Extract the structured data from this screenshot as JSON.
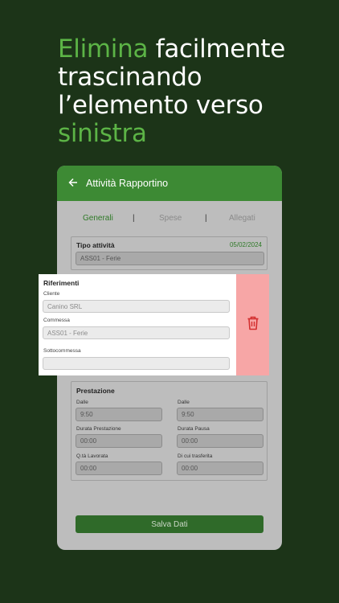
{
  "headline": {
    "part1": "Elimina",
    "part2": " facilmente trascinando l’elemento verso ",
    "part3": "sinistra"
  },
  "appbar": {
    "back_icon": "arrow-left-icon",
    "title": "Attività Rapportino"
  },
  "tabs": [
    {
      "label": "Generali",
      "active": true
    },
    {
      "label": "Spese",
      "active": false
    },
    {
      "label": "Allegati",
      "active": false
    }
  ],
  "tab_separator": "|",
  "tipo_attivita": {
    "label": "Tipo attività",
    "date": "05/02/2024",
    "value": "ASS01 - Ferie"
  },
  "riferimenti": {
    "title": "Riferimenti",
    "cliente_label": "Cliente",
    "cliente_value": "Canino SRL",
    "commessa_label": "Commessa",
    "commessa_value": "ASS01 - Ferie",
    "sottocommessa_label": "Sottocommessa",
    "sottocommessa_value": ""
  },
  "prestazione": {
    "title": "Prestazione",
    "dalle1_label": "Dalle",
    "dalle1_value": "9:50",
    "dalle2_label": "Dalle",
    "dalle2_value": "9:50",
    "durata_prest_label": "Durata Prestazione",
    "durata_prest_value": "00:00",
    "durata_pausa_label": "Durata Pausa",
    "durata_pausa_value": "00:00",
    "qta_label": "Q.tà Lavorata",
    "qta_value": "00:00",
    "trasferta_label": "Di cui trasferita",
    "trasferta_value": "00:00"
  },
  "save_label": "Salva Dati",
  "delete_icon": "trash-icon",
  "colors": {
    "background": "#1c3418",
    "accent": "#5cb446",
    "appbar": "#3d8a34",
    "delete": "#f7a6a6",
    "delete_icon": "#d32f2f"
  }
}
